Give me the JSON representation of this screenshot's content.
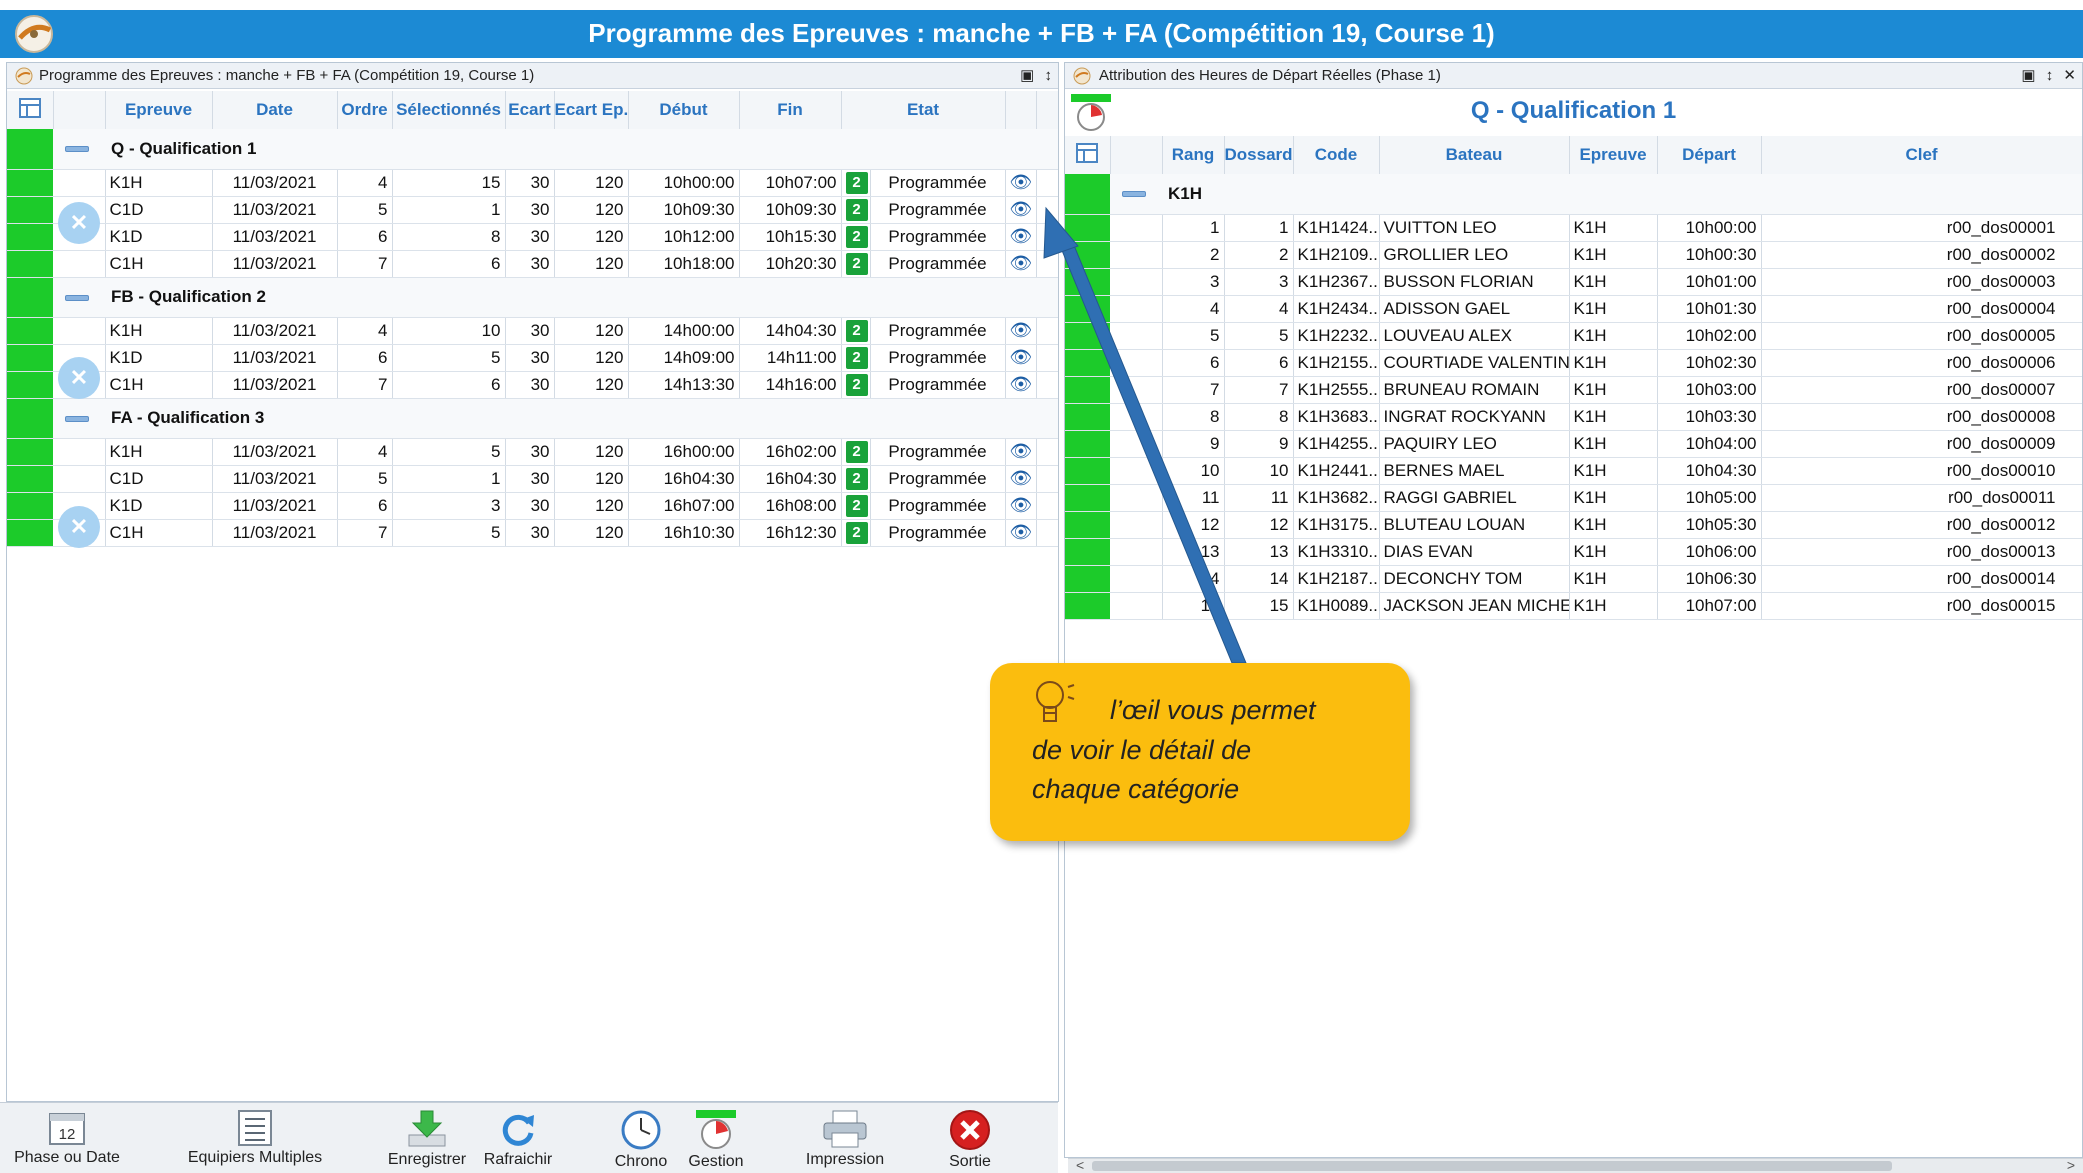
{
  "window": {
    "title": "Programme des Epreuves : manche + FB + FA (Compétition 19, Course 1)"
  },
  "left_panel": {
    "title": "Programme des Epreuves : manche + FB + FA (Compétition 19, Course 1)",
    "columns": [
      "Epreuve",
      "Date",
      "Ordre",
      "Sélectionnés",
      "Ecart",
      "Ecart Ep.",
      "Début",
      "Fin",
      "Etat"
    ],
    "groups": [
      {
        "title": "Q - Qualification 1",
        "rows": [
          {
            "epreuve": "K1H",
            "date": "11/03/2021",
            "ordre": "4",
            "selectionnes": "15",
            "ecart": "30",
            "ecart_ep": "120",
            "debut": "10h00:00",
            "fin": "10h07:00",
            "badge": "2",
            "etat": "Programmée"
          },
          {
            "epreuve": "C1D",
            "date": "11/03/2021",
            "ordre": "5",
            "selectionnes": "1",
            "ecart": "30",
            "ecart_ep": "120",
            "debut": "10h09:30",
            "fin": "10h09:30",
            "badge": "2",
            "etat": "Programmée"
          },
          {
            "epreuve": "K1D",
            "date": "11/03/2021",
            "ordre": "6",
            "selectionnes": "8",
            "ecart": "30",
            "ecart_ep": "120",
            "debut": "10h12:00",
            "fin": "10h15:30",
            "badge": "2",
            "etat": "Programmée"
          },
          {
            "epreuve": "C1H",
            "date": "11/03/2021",
            "ordre": "7",
            "selectionnes": "6",
            "ecart": "30",
            "ecart_ep": "120",
            "debut": "10h18:00",
            "fin": "10h20:30",
            "badge": "2",
            "etat": "Programmée"
          }
        ]
      },
      {
        "title": "FB - Qualification 2",
        "rows": [
          {
            "epreuve": "K1H",
            "date": "11/03/2021",
            "ordre": "4",
            "selectionnes": "10",
            "ecart": "30",
            "ecart_ep": "120",
            "debut": "14h00:00",
            "fin": "14h04:30",
            "badge": "2",
            "etat": "Programmée"
          },
          {
            "epreuve": "K1D",
            "date": "11/03/2021",
            "ordre": "6",
            "selectionnes": "5",
            "ecart": "30",
            "ecart_ep": "120",
            "debut": "14h09:00",
            "fin": "14h11:00",
            "badge": "2",
            "etat": "Programmée"
          },
          {
            "epreuve": "C1H",
            "date": "11/03/2021",
            "ordre": "7",
            "selectionnes": "6",
            "ecart": "30",
            "ecart_ep": "120",
            "debut": "14h13:30",
            "fin": "14h16:00",
            "badge": "2",
            "etat": "Programmée"
          }
        ]
      },
      {
        "title": "FA - Qualification 3",
        "rows": [
          {
            "epreuve": "K1H",
            "date": "11/03/2021",
            "ordre": "4",
            "selectionnes": "5",
            "ecart": "30",
            "ecart_ep": "120",
            "debut": "16h00:00",
            "fin": "16h02:00",
            "badge": "2",
            "etat": "Programmée"
          },
          {
            "epreuve": "C1D",
            "date": "11/03/2021",
            "ordre": "5",
            "selectionnes": "1",
            "ecart": "30",
            "ecart_ep": "120",
            "debut": "16h04:30",
            "fin": "16h04:30",
            "badge": "2",
            "etat": "Programmée"
          },
          {
            "epreuve": "K1D",
            "date": "11/03/2021",
            "ordre": "6",
            "selectionnes": "3",
            "ecart": "30",
            "ecart_ep": "120",
            "debut": "16h07:00",
            "fin": "16h08:00",
            "badge": "2",
            "etat": "Programmée"
          },
          {
            "epreuve": "C1H",
            "date": "11/03/2021",
            "ordre": "7",
            "selectionnes": "5",
            "ecart": "30",
            "ecart_ep": "120",
            "debut": "16h10:30",
            "fin": "16h12:30",
            "badge": "2",
            "etat": "Programmée"
          }
        ]
      }
    ]
  },
  "right_panel": {
    "title": "Attribution des Heures de Départ Réelles (Phase 1)",
    "heading": "Q - Qualification 1",
    "columns": [
      "Rang",
      "Dossard",
      "Code",
      "Bateau",
      "Epreuve",
      "Départ",
      "Clef"
    ],
    "group": "K1H",
    "rows": [
      {
        "rang": "1",
        "dossard": "1",
        "code": "K1H1424...",
        "bateau": "VUITTON LEO",
        "epreuve": "K1H",
        "depart": "10h00:00",
        "clef": "r00_dos00001"
      },
      {
        "rang": "2",
        "dossard": "2",
        "code": "K1H2109...",
        "bateau": "GROLLIER LEO",
        "epreuve": "K1H",
        "depart": "10h00:30",
        "clef": "r00_dos00002"
      },
      {
        "rang": "3",
        "dossard": "3",
        "code": "K1H2367...",
        "bateau": "BUSSON FLORIAN",
        "epreuve": "K1H",
        "depart": "10h01:00",
        "clef": "r00_dos00003"
      },
      {
        "rang": "4",
        "dossard": "4",
        "code": "K1H2434...",
        "bateau": "ADISSON GAEL",
        "epreuve": "K1H",
        "depart": "10h01:30",
        "clef": "r00_dos00004"
      },
      {
        "rang": "5",
        "dossard": "5",
        "code": "K1H2232...",
        "bateau": "LOUVEAU ALEX",
        "epreuve": "K1H",
        "depart": "10h02:00",
        "clef": "r00_dos00005"
      },
      {
        "rang": "6",
        "dossard": "6",
        "code": "K1H2155...",
        "bateau": "COURTIADE VALENTIN",
        "epreuve": "K1H",
        "depart": "10h02:30",
        "clef": "r00_dos00006"
      },
      {
        "rang": "7",
        "dossard": "7",
        "code": "K1H2555...",
        "bateau": "BRUNEAU ROMAIN",
        "epreuve": "K1H",
        "depart": "10h03:00",
        "clef": "r00_dos00007"
      },
      {
        "rang": "8",
        "dossard": "8",
        "code": "K1H3683...",
        "bateau": "INGRAT ROCKYANN",
        "epreuve": "K1H",
        "depart": "10h03:30",
        "clef": "r00_dos00008"
      },
      {
        "rang": "9",
        "dossard": "9",
        "code": "K1H4255...",
        "bateau": "PAQUIRY LEO",
        "epreuve": "K1H",
        "depart": "10h04:00",
        "clef": "r00_dos00009"
      },
      {
        "rang": "10",
        "dossard": "10",
        "code": "K1H2441...",
        "bateau": "BERNES MAEL",
        "epreuve": "K1H",
        "depart": "10h04:30",
        "clef": "r00_dos00010"
      },
      {
        "rang": "11",
        "dossard": "11",
        "code": "K1H3682...",
        "bateau": "RAGGI GABRIEL",
        "epreuve": "K1H",
        "depart": "10h05:00",
        "clef": "r00_dos00011"
      },
      {
        "rang": "12",
        "dossard": "12",
        "code": "K1H3175...",
        "bateau": "BLUTEAU LOUAN",
        "epreuve": "K1H",
        "depart": "10h05:30",
        "clef": "r00_dos00012"
      },
      {
        "rang": "13",
        "dossard": "13",
        "code": "K1H3310...",
        "bateau": "DIAS EVAN",
        "epreuve": "K1H",
        "depart": "10h06:00",
        "clef": "r00_dos00013"
      },
      {
        "rang": "14",
        "dossard": "14",
        "code": "K1H2187...",
        "bateau": "DECONCHY TOM",
        "epreuve": "K1H",
        "depart": "10h06:30",
        "clef": "r00_dos00014"
      },
      {
        "rang": "15",
        "dossard": "15",
        "code": "K1H0089...",
        "bateau": "JACKSON JEAN MICHEL",
        "epreuve": "K1H",
        "depart": "10h07:00",
        "clef": "r00_dos00015"
      }
    ]
  },
  "toolbar": {
    "phase_label": "Phase ou Date",
    "phase_icon_text": "12",
    "equipiers_label": "Equipiers Multiples",
    "enregistrer_label": "Enregistrer",
    "rafraichir_label": "Rafraichir",
    "chrono_label": "Chrono",
    "gestion_label": "Gestion",
    "impression_label": "Impression",
    "sortie_label": "Sortie"
  },
  "callout": {
    "line1": "l’œil vous permet",
    "line2": "de voir le détail de",
    "line3": "chaque catégorie"
  },
  "colors": {
    "title_bar": "#1c8ad4",
    "header_text": "#2b74c0",
    "row_green": "#1ccb2a",
    "badge_green": "#19a23a",
    "callout": "#fbbd0e",
    "arrow": "#2f6fb3",
    "sortie_red": "#d62020"
  }
}
